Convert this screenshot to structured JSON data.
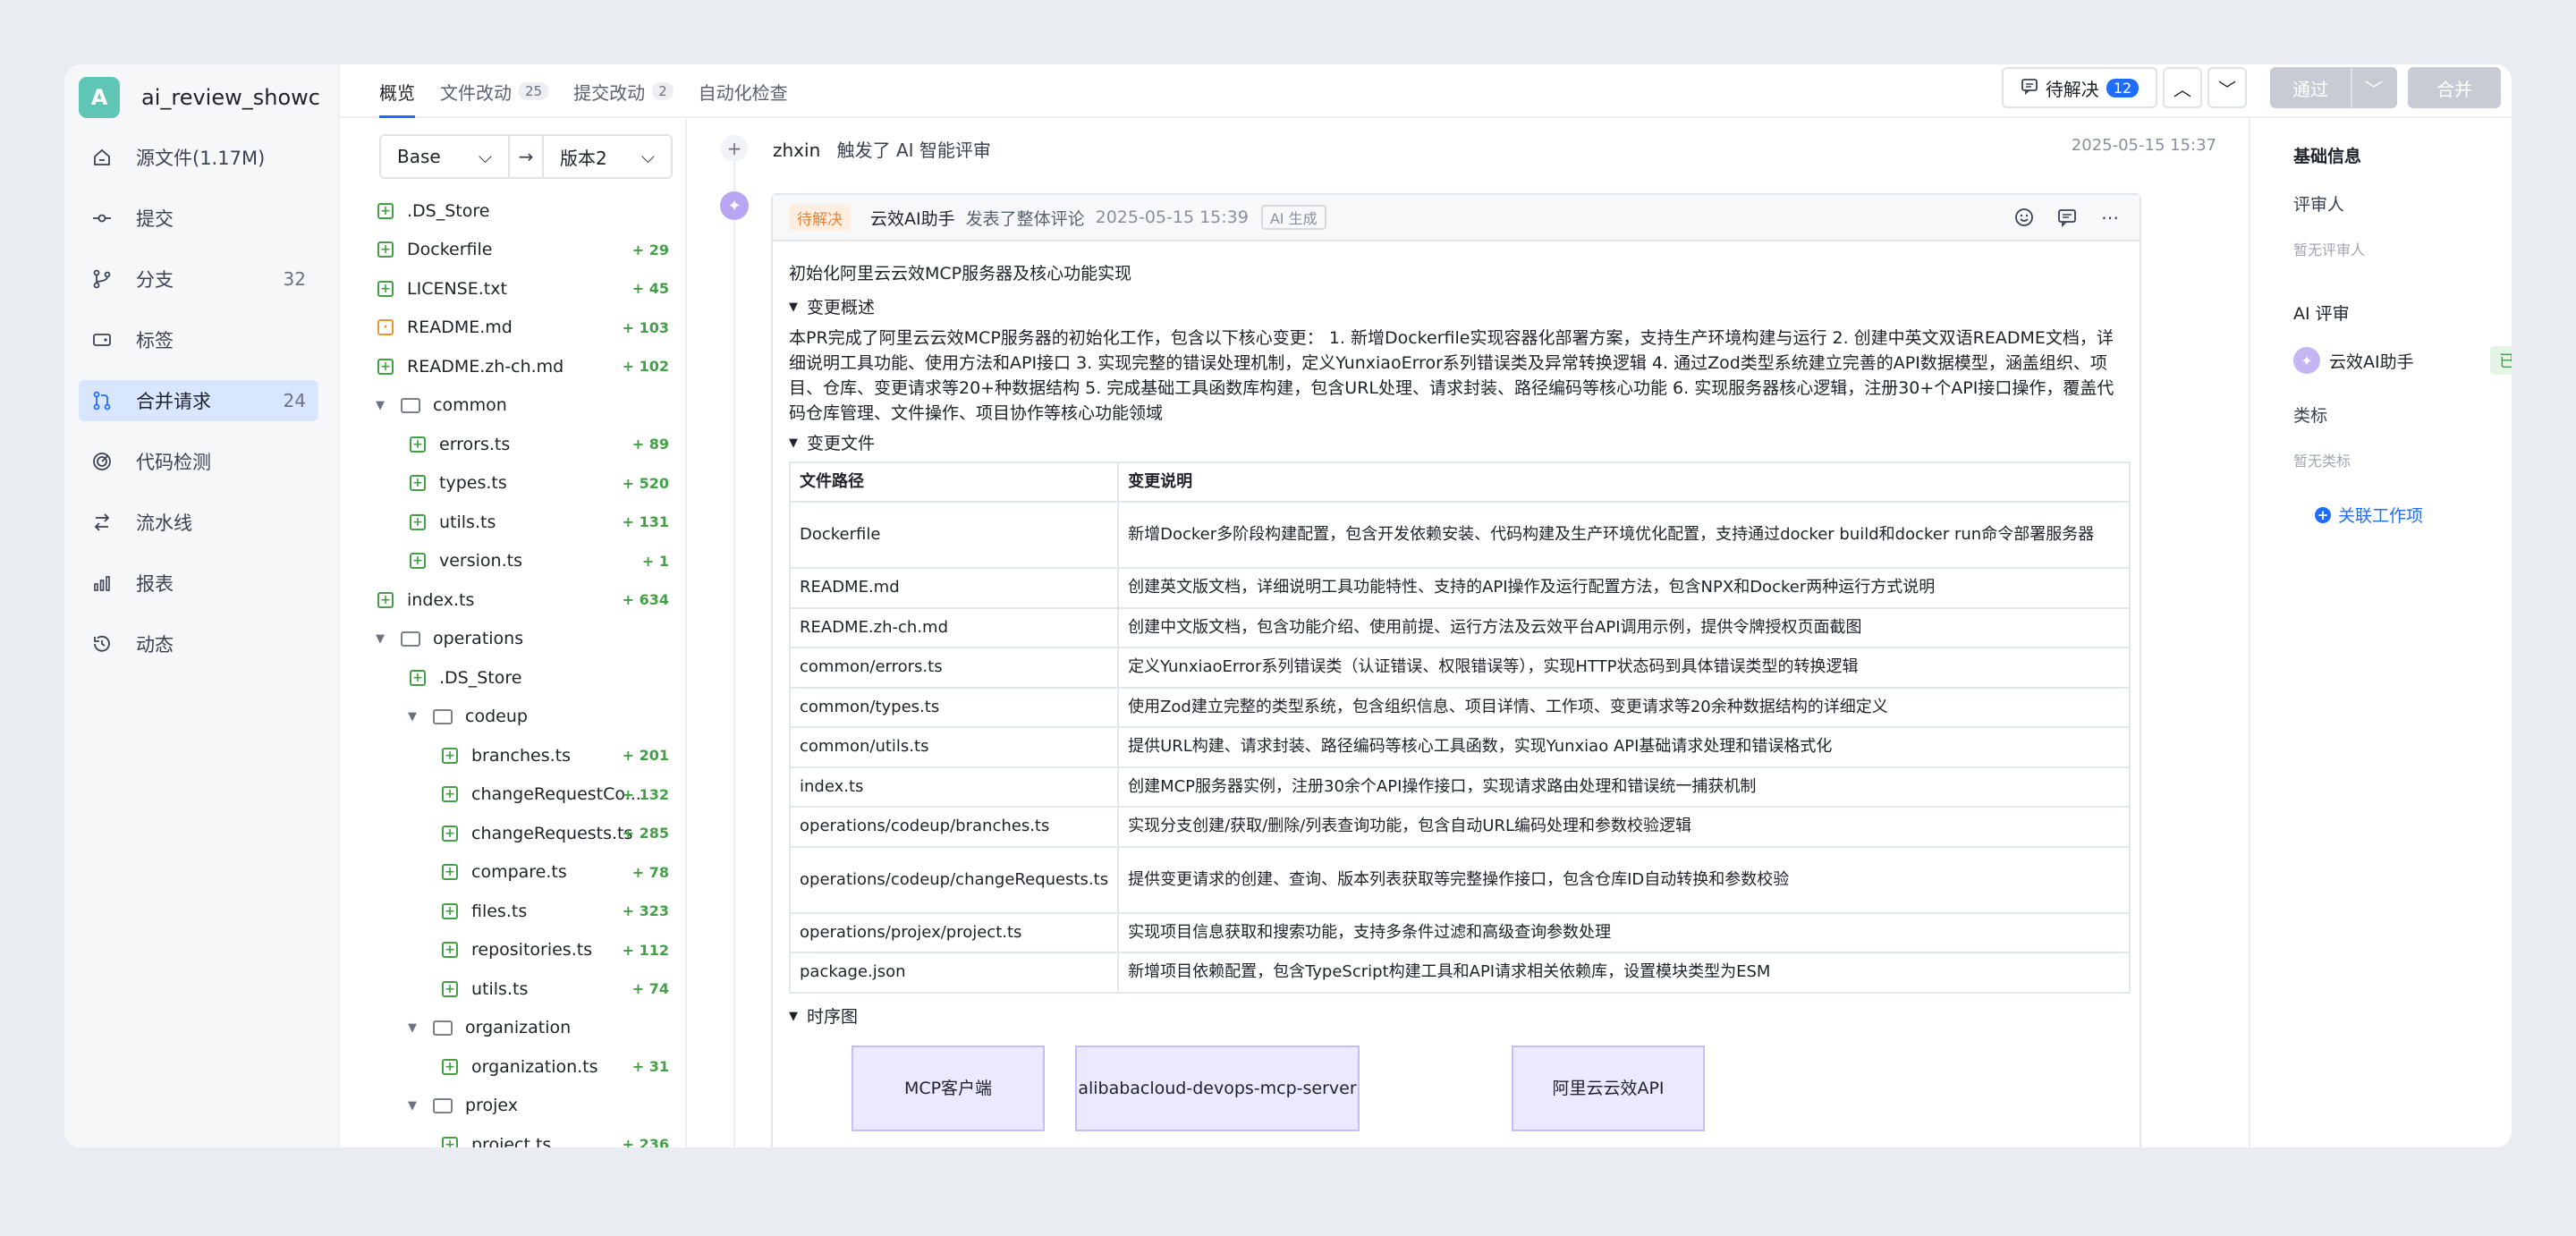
{
  "repo": {
    "initial": "A",
    "name": "ai_review_showc..."
  },
  "nav": [
    {
      "label": "源文件(1.17M)",
      "icon": "home-icon",
      "count": ""
    },
    {
      "label": "提交",
      "icon": "commit-icon",
      "count": ""
    },
    {
      "label": "分支",
      "icon": "branch-icon",
      "count": "32"
    },
    {
      "label": "标签",
      "icon": "tag-icon",
      "count": ""
    },
    {
      "label": "合并请求",
      "icon": "merge-request-icon",
      "count": "24",
      "active": true
    },
    {
      "label": "代码检测",
      "icon": "scan-icon",
      "count": ""
    },
    {
      "label": "流水线",
      "icon": "pipeline-icon",
      "count": ""
    },
    {
      "label": "报表",
      "icon": "chart-icon",
      "count": ""
    },
    {
      "label": "动态",
      "icon": "history-icon",
      "count": ""
    }
  ],
  "tabs": [
    {
      "label": "概览",
      "count": ""
    },
    {
      "label": "文件改动",
      "count": "25"
    },
    {
      "label": "提交改动",
      "count": "2"
    },
    {
      "label": "自动化检查",
      "count": ""
    }
  ],
  "toolbar": {
    "pending_label": "待解决",
    "pending_count": "12",
    "approve_label": "通过",
    "merge_label": "合并"
  },
  "compare": {
    "base": "Base",
    "target": "版本2"
  },
  "tree": [
    {
      "name": ".DS_Store",
      "indent": 0,
      "type": "file",
      "add": ""
    },
    {
      "name": "Dockerfile",
      "indent": 0,
      "type": "file",
      "add": "+ 29"
    },
    {
      "name": "LICENSE.txt",
      "indent": 0,
      "type": "file",
      "add": "+ 45"
    },
    {
      "name": "README.md",
      "indent": 0,
      "type": "mod",
      "add": "+ 103"
    },
    {
      "name": "README.zh-ch.md",
      "indent": 0,
      "type": "file",
      "add": "+ 102"
    },
    {
      "name": "common",
      "indent": 0,
      "type": "folder",
      "add": ""
    },
    {
      "name": "errors.ts",
      "indent": 1,
      "type": "file",
      "add": "+ 89"
    },
    {
      "name": "types.ts",
      "indent": 1,
      "type": "file",
      "add": "+ 520"
    },
    {
      "name": "utils.ts",
      "indent": 1,
      "type": "file",
      "add": "+ 131"
    },
    {
      "name": "version.ts",
      "indent": 1,
      "type": "file",
      "add": "+ 1"
    },
    {
      "name": "index.ts",
      "indent": 0,
      "type": "file",
      "add": "+ 634"
    },
    {
      "name": "operations",
      "indent": 0,
      "type": "folder",
      "add": ""
    },
    {
      "name": ".DS_Store",
      "indent": 1,
      "type": "file",
      "add": ""
    },
    {
      "name": "codeup",
      "indent": 1,
      "type": "folder",
      "add": ""
    },
    {
      "name": "branches.ts",
      "indent": 2,
      "type": "file",
      "add": "+ 201"
    },
    {
      "name": "changeRequestCo...",
      "indent": 2,
      "type": "file",
      "add": "+ 132"
    },
    {
      "name": "changeRequests.ts",
      "indent": 2,
      "type": "file",
      "add": "+ 285"
    },
    {
      "name": "compare.ts",
      "indent": 2,
      "type": "file",
      "add": "+ 78"
    },
    {
      "name": "files.ts",
      "indent": 2,
      "type": "file",
      "add": "+ 323"
    },
    {
      "name": "repositories.ts",
      "indent": 2,
      "type": "file",
      "add": "+ 112"
    },
    {
      "name": "utils.ts",
      "indent": 2,
      "type": "file",
      "add": "+ 74"
    },
    {
      "name": "organization",
      "indent": 1,
      "type": "folder",
      "add": ""
    },
    {
      "name": "organization.ts",
      "indent": 2,
      "type": "file",
      "add": "+ 31"
    },
    {
      "name": "projex",
      "indent": 1,
      "type": "folder",
      "add": ""
    },
    {
      "name": "project.ts",
      "indent": 2,
      "type": "file",
      "add": "+ 236"
    }
  ],
  "timeline": {
    "user": "zhxin",
    "action": "触发了 AI 智能评审",
    "time": "2025-05-15 15:37"
  },
  "comment": {
    "status": "待解决",
    "author": "云效AI助手",
    "action": "发表了整体评论",
    "time": "2025-05-15 15:39",
    "ai_tag": "AI 生成",
    "title": "初始化阿里云云效MCP服务器及核心功能实现",
    "sec_overview": "变更概述",
    "overview": "本PR完成了阿里云云效MCP服务器的初始化工作，包含以下核心变更： 1. 新增Dockerfile实现容器化部署方案，支持生产环境构建与运行 2. 创建中英文双语README文档，详细说明工具功能、使用方法和API接口 3. 实现完整的错误处理机制，定义YunxiaoError系列错误类及异常转换逻辑 4. 通过Zod类型系统建立完善的API数据模型，涵盖组织、项目、仓库、变更请求等20+种数据结构 5. 完成基础工具函数库构建，包含URL处理、请求封装、路径编码等核心功能 6. 实现服务器核心逻辑，注册30+个API接口操作，覆盖代码仓库管理、文件操作、项目协作等核心功能领域",
    "sec_files": "变更文件",
    "col_path": "文件路径",
    "col_desc": "变更说明",
    "rows": [
      {
        "path": "Dockerfile",
        "desc": "新增Docker多阶段构建配置，包含开发依赖安装、代码构建及生产环境优化配置，支持通过docker build和docker run命令部署服务器"
      },
      {
        "path": "README.md",
        "desc": "创建英文版文档，详细说明工具功能特性、支持的API操作及运行配置方法，包含NPX和Docker两种运行方式说明"
      },
      {
        "path": "README.zh-ch.md",
        "desc": "创建中文版文档，包含功能介绍、使用前提、运行方法及云效平台API调用示例，提供令牌授权页面截图"
      },
      {
        "path": "common/errors.ts",
        "desc": "定义YunxiaoError系列错误类（认证错误、权限错误等），实现HTTP状态码到具体错误类型的转换逻辑"
      },
      {
        "path": "common/types.ts",
        "desc": "使用Zod建立完整的类型系统，包含组织信息、项目详情、工作项、变更请求等20余种数据结构的详细定义"
      },
      {
        "path": "common/utils.ts",
        "desc": "提供URL构建、请求封装、路径编码等核心工具函数，实现Yunxiao API基础请求处理和错误格式化"
      },
      {
        "path": "index.ts",
        "desc": "创建MCP服务器实例，注册30余个API操作接口，实现请求路由处理和错误统一捕获机制"
      },
      {
        "path": "operations/codeup/branches.ts",
        "desc": "实现分支创建/获取/删除/列表查询功能，包含自动URL编码处理和参数校验逻辑"
      },
      {
        "path": "operations/codeup/changeRequests.ts",
        "desc": "提供变更请求的创建、查询、版本列表获取等完整操作接口，包含仓库ID自动转换和参数校验"
      },
      {
        "path": "operations/projex/project.ts",
        "desc": "实现项目信息获取和搜索功能，支持多条件过滤和高级查询参数处理"
      },
      {
        "path": "package.json",
        "desc": "新增项目依赖配置，包含TypeScript构建工具和API请求相关依赖库，设置模块类型为ESM"
      }
    ],
    "sec_seq": "时序图",
    "seq": [
      "MCP客户端",
      "alibabacloud-devops-mcp-server",
      "阿里云云效API"
    ]
  },
  "right": {
    "basic": "基础信息",
    "reviewer": "评审人",
    "no_reviewer": "暂无评审人",
    "ai_review": "AI 评审",
    "ai_name": "云效AI助手",
    "reviewed": "已评审",
    "labels": "类标",
    "no_labels": "暂无类标",
    "link_work": "关联工作项"
  }
}
